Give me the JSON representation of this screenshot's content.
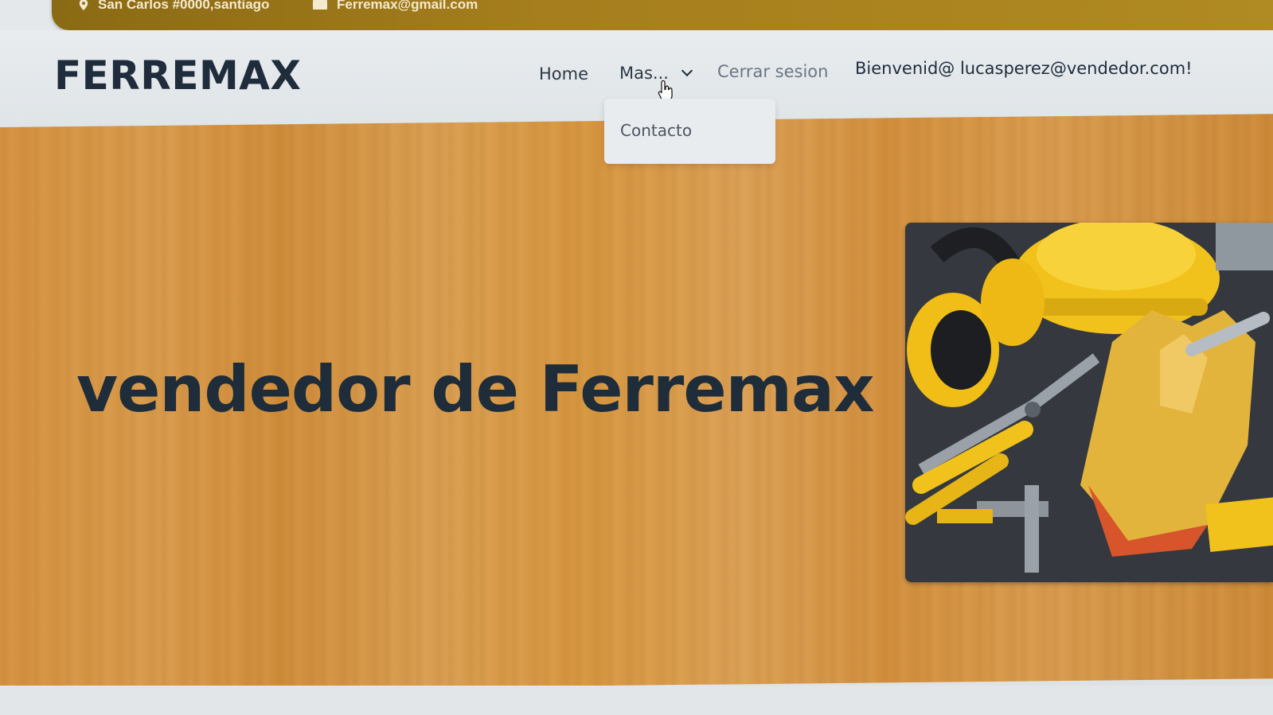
{
  "topbar": {
    "address": "San Carlos #0000,santiago",
    "email": "Ferremax@gmail.com",
    "background": "#a67e1d"
  },
  "navbar": {
    "brand": "FERREMAX",
    "home_label": "Home",
    "mas_label": "Mas...",
    "cerrar_label": "Cerrar sesion",
    "welcome_label": "Bienvenid@ lucasperez@vendedor.com!"
  },
  "dropdown": {
    "items": [
      {
        "label": "Contacto"
      }
    ]
  },
  "hero": {
    "title": "vendedor de Ferremax",
    "image_alt": "tools-image",
    "text_color": "#1f2d3b"
  },
  "icons": {
    "pin": "map-pin-icon",
    "mail": "mail-icon",
    "chevron": "chevron-down-icon",
    "cursor": "hand-cursor-icon"
  }
}
